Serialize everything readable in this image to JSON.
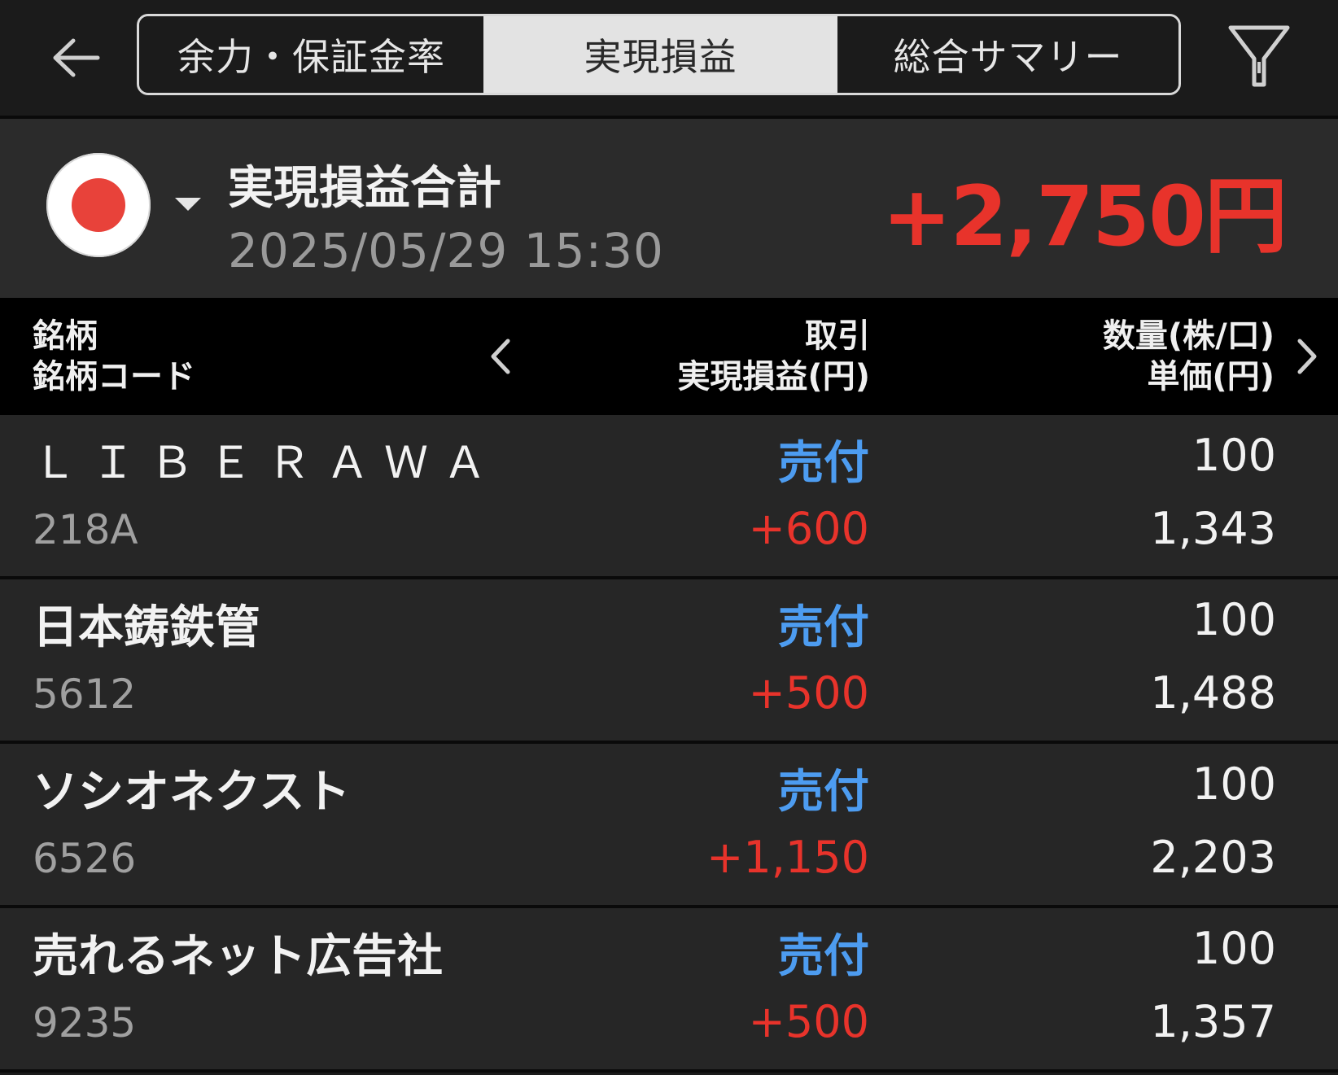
{
  "header": {
    "tabs": [
      {
        "label": "余力・保証金率",
        "active": false
      },
      {
        "label": "実現損益",
        "active": true
      },
      {
        "label": "総合サマリー",
        "active": false
      }
    ],
    "back_icon": "arrow-left-icon",
    "filter_icon": "filter-icon"
  },
  "summary": {
    "market_flag": "japan-flag-icon",
    "title": "実現損益合計",
    "datetime": "2025/05/29  15:30",
    "total": "+2,750円",
    "total_color": "#e8332b"
  },
  "columns": {
    "name_line1": "銘柄",
    "name_line2": "銘柄コード",
    "trade_line1": "取引",
    "trade_line2": "実現損益(円)",
    "qty_line1": "数量(株/口)",
    "qty_line2": "単価(円)"
  },
  "rows": [
    {
      "name": "ＬＩＢＥＲＡＷＡ…",
      "code": "218A",
      "side": "売付",
      "pl": "+600",
      "qty": "100",
      "price": "1,343"
    },
    {
      "name": "日本鋳鉄管",
      "code": "5612",
      "side": "売付",
      "pl": "+500",
      "qty": "100",
      "price": "1,488"
    },
    {
      "name": "ソシオネクスト",
      "code": "6526",
      "side": "売付",
      "pl": "+1,150",
      "qty": "100",
      "price": "2,203"
    },
    {
      "name": "売れるネット広告社",
      "code": "9235",
      "side": "売付",
      "pl": "+500",
      "qty": "100",
      "price": "1,357"
    }
  ],
  "colors": {
    "sell_side": "#4d9cf0",
    "profit": "#e8332b",
    "background": "#1a1a1a"
  }
}
